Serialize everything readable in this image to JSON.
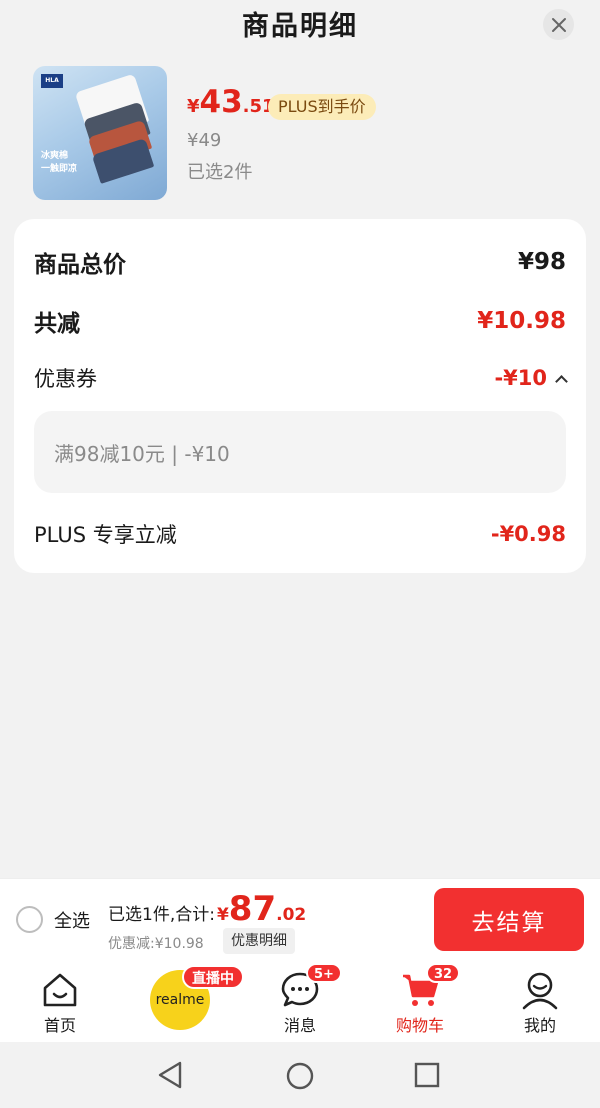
{
  "header": {
    "title": "商品明细",
    "close_icon": "close-icon"
  },
  "product": {
    "brand_logo": "HLA",
    "image_text_1": "冰爽棉",
    "image_text_2": "一触即凉",
    "price_symbol": "¥",
    "price_int": "43",
    "price_dec": ".51",
    "plus_tag": "PLUS到手价",
    "original_price": "¥49",
    "selected_count": "已选2件"
  },
  "summary": {
    "total_label": "商品总价",
    "total_value": "¥98",
    "reduce_label": "共减",
    "reduce_value": "¥10.98",
    "coupon_label": "优惠券",
    "coupon_value": "-¥10",
    "coupon_detail": "满98减10元 | -¥10",
    "plus_label": "PLUS 专享立减",
    "plus_value": "-¥0.98"
  },
  "checkout": {
    "select_all": "全选",
    "sum_label": "已选1件,合计:",
    "sum_symbol": "¥",
    "sum_int": "87",
    "sum_dec": ".02",
    "discount": "优惠减:¥10.98",
    "detail_button": "优惠明细",
    "go_button": "去结算"
  },
  "tabs": [
    {
      "label": "首页",
      "icon": "home-icon"
    },
    {
      "label": "realme",
      "icon": "realme-live-icon",
      "badge": "直播中"
    },
    {
      "label": "消息",
      "icon": "message-icon",
      "badge": "5+"
    },
    {
      "label": "购物车",
      "icon": "cart-icon",
      "badge": "32"
    },
    {
      "label": "我的",
      "icon": "profile-icon"
    }
  ],
  "colors": {
    "accent": "#e1251b",
    "button": "#f23030",
    "plus_tag_bg": "#fcecb8"
  }
}
